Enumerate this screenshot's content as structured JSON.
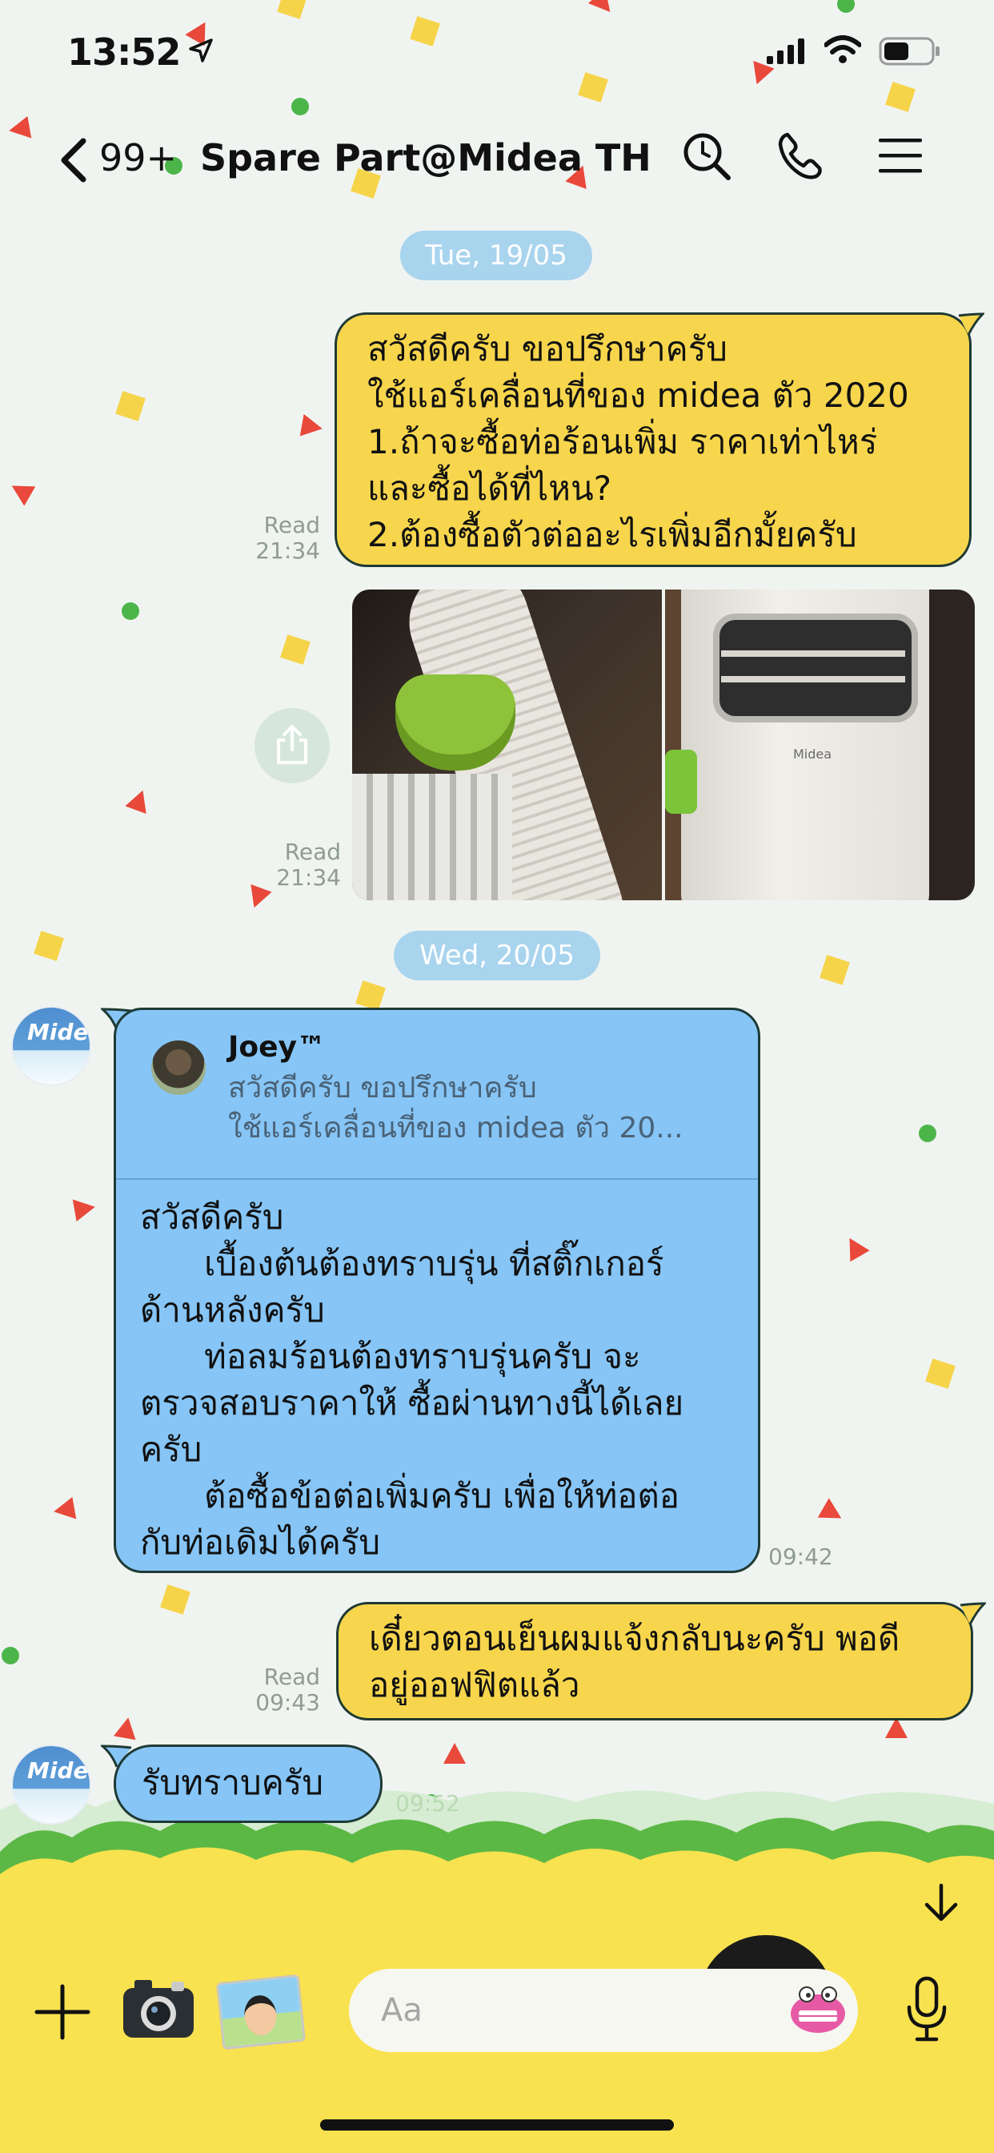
{
  "status_bar": {
    "time": "13:52"
  },
  "header": {
    "back_count": "99+",
    "title": "Spare Part@Midea TH"
  },
  "dates": {
    "first": "Tue, 19/05",
    "second": "Wed, 20/05"
  },
  "messages": {
    "m1": {
      "text": "สวัสดีครับ ขอปรึกษาครับ\nใช้แอร์เคลื่อนที่ของ midea ตัว 2020\n1.ถ้าจะซื้อท่อร้อนเพิ่ม ราคาเท่าไหร่\nและซื้อได้ที่ไหน?\n2.ต้องซื้อตัวต่ออะไรเพิ่มอีกมั้ยครับ",
      "read": "Read",
      "time": "21:34"
    },
    "m2": {
      "read": "Read",
      "time": "21:34",
      "photo_brand": "Midea"
    },
    "m3": {
      "reply_name": "Joey™",
      "reply_line1": "สวัสดีครับ ขอปรึกษาครับ",
      "reply_line2": "ใช้แอร์เคลื่อนที่ของ midea ตัว 20...",
      "text": "สวัสดีครับ\n      เบื้องต้นต้องทราบรุ่น ที่สติ๊กเกอร์\nด้านหลังครับ\n      ท่อลมร้อนต้องทราบรุ่นครับ จะ\nตรวจสอบราคาให้ ซื้อผ่านทางนี้ได้เลย\nครับ\n      ต้อซื้อข้อต่อเพิ่มครับ เพื่อให้ท่อต่อ\nกับท่อเดิมได้ครับ",
      "time": "09:42"
    },
    "m4": {
      "text": "เดี๋ยวตอนเย็นผมแจ้งกลับนะครับ พอดี\nอยู่ออฟฟิตแล้ว",
      "read": "Read",
      "time": "09:43"
    },
    "m5": {
      "text": "รับทราบครับ",
      "time": "09:52"
    }
  },
  "avatar_label": "Midea",
  "input": {
    "placeholder": "Aa"
  },
  "colors": {
    "background": "#f0f4f1",
    "outgoing_bubble": "#f7d64d",
    "incoming_bubble": "#86c5f6",
    "date_pill": "#a9d4ee",
    "bottom_theme": "#f9e24f",
    "grass": "#5cb845"
  },
  "icons": {
    "back": "chevron-left-icon",
    "search": "search-icon",
    "call": "phone-icon",
    "menu": "hamburger-menu-icon",
    "share": "share-icon",
    "plus": "plus-icon",
    "camera": "camera-icon",
    "photo": "photo-icon",
    "sticker": "sticker-icon",
    "mic": "microphone-icon",
    "scroll_down": "arrow-down-icon"
  }
}
